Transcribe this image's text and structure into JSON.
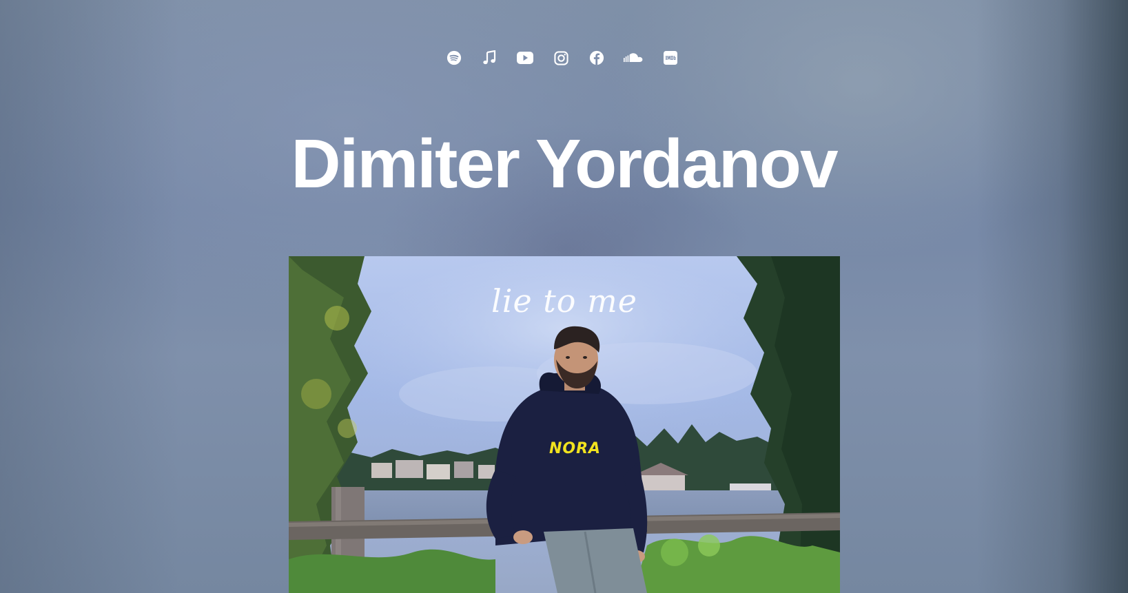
{
  "artist": {
    "name": "Dimiter Yordanov"
  },
  "social_links": [
    {
      "icon": "spotify-icon"
    },
    {
      "icon": "music-note-icon"
    },
    {
      "icon": "youtube-icon"
    },
    {
      "icon": "instagram-icon"
    },
    {
      "icon": "facebook-icon"
    },
    {
      "icon": "soundcloud-icon"
    },
    {
      "icon": "imdb-icon"
    }
  ],
  "cover": {
    "title_text": "lie to me",
    "hoodie_text": "NORA"
  },
  "colors": {
    "background": "#7d8ea6",
    "text": "#ffffff",
    "hoodie_accent": "#f1e21f"
  }
}
